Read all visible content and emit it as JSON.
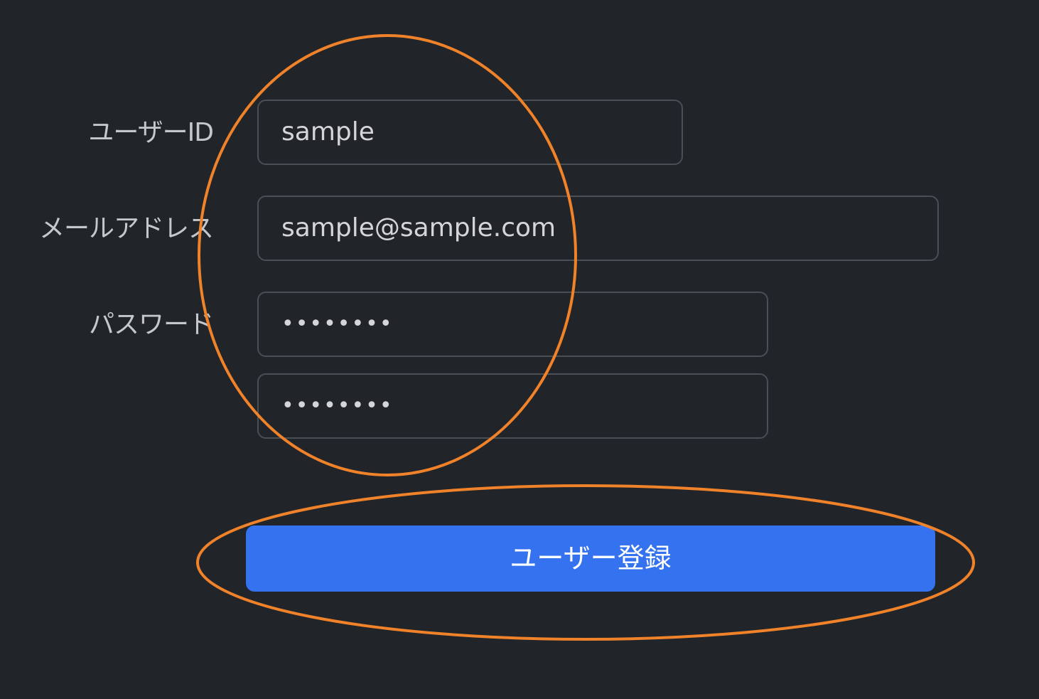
{
  "form": {
    "user_id_label": "ユーザーID",
    "user_id_value": "sample",
    "email_label": "メールアドレス",
    "email_value": "sample@sample.com",
    "password_label": "パスワード",
    "password_value": "••••••••",
    "password_confirm_value": "••••••••",
    "submit_label": "ユーザー登録"
  },
  "colors": {
    "background": "#212429",
    "field_border": "#4a4e55",
    "button": "#3572f0",
    "annotation": "#f0822a"
  }
}
